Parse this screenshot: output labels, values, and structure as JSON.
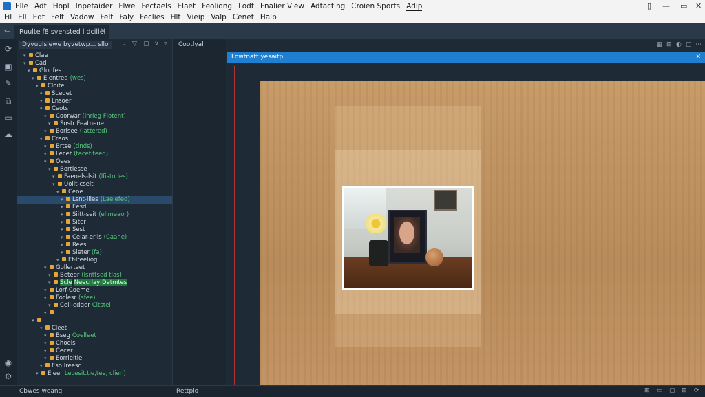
{
  "menubar": {
    "row1": [
      "Elle",
      "Adt",
      "Hopl",
      "Inpetaider",
      "Flwe",
      "Fectaels",
      "Elaet",
      "Feoliong",
      "Lodt",
      "Fnalier View",
      "Adtacting",
      "Croien Sports",
      "Adip"
    ],
    "row2": [
      "Fil",
      "Ell",
      "Edt",
      "Felt",
      "Vadow",
      "Felt",
      "Faly",
      "Feclies",
      "Hlt",
      "Vieip",
      "Valp",
      "Cenet",
      "Halp"
    ],
    "window_controls": [
      "▯",
      "—",
      "▭",
      "✕"
    ]
  },
  "tab": {
    "label": "Ruulte f8 svensted l dcillel",
    "close": "✕"
  },
  "tree": {
    "header_title": "Dyvuulsiewe byvetwp… sllo",
    "rows": [
      {
        "depth": 1,
        "label": "Clae"
      },
      {
        "depth": 1,
        "label": "Cad"
      },
      {
        "depth": 2,
        "label": "Glonfes"
      },
      {
        "depth": 3,
        "label": "Elentred",
        "detail": "(wes)"
      },
      {
        "depth": 4,
        "label": "Cloite"
      },
      {
        "depth": 5,
        "label": "Scedet"
      },
      {
        "depth": 5,
        "label": "Lnsoer"
      },
      {
        "depth": 5,
        "label": "Ceots"
      },
      {
        "depth": 6,
        "label": "Coorwar",
        "detail": "(inrleg Flotent)"
      },
      {
        "depth": 7,
        "label": "Sostr Featnene"
      },
      {
        "depth": 6,
        "label": "Borisee",
        "detail": "(lattered)"
      },
      {
        "depth": 5,
        "label": "Creos"
      },
      {
        "depth": 6,
        "label": "Brtse",
        "detail": "(tinds)"
      },
      {
        "depth": 6,
        "label": "Lecet",
        "detail": "(tacetiteed)"
      },
      {
        "depth": 6,
        "label": "Oaes"
      },
      {
        "depth": 7,
        "label": "Bortlesse"
      },
      {
        "depth": 8,
        "label": "Faenels-lsit",
        "detail": "(lfistodes)"
      },
      {
        "depth": 8,
        "label": "Uoilt-cselt"
      },
      {
        "depth": 9,
        "label": "Ceoe"
      },
      {
        "depth": 10,
        "label": "Lsnt-liies",
        "detail": "(Laelefed)",
        "selected": true
      },
      {
        "depth": 10,
        "label": "Eesd"
      },
      {
        "depth": 10,
        "label": "Siitt-seit",
        "detail": "(ellmeaor)"
      },
      {
        "depth": 10,
        "label": "Siter"
      },
      {
        "depth": 10,
        "label": "Sest"
      },
      {
        "depth": 10,
        "label": "Ceiar-erlls",
        "detail": "(Caane)"
      },
      {
        "depth": 10,
        "label": "Rees"
      },
      {
        "depth": 10,
        "label": "Sleter",
        "detail": "(fa)"
      },
      {
        "depth": 9,
        "label": "Ef-lteeliog"
      },
      {
        "depth": 6,
        "label": "Gollerteet"
      },
      {
        "depth": 7,
        "label": "Beteer",
        "detail": "(lsnttsed tlas)"
      },
      {
        "depth": 7,
        "label": "Scle",
        "detail": "Neecrlay Detmtes",
        "highlight": true
      },
      {
        "depth": 6,
        "label": "Lorf-Coeme"
      },
      {
        "depth": 6,
        "label": "Foclesr",
        "detail": "(sfee)"
      },
      {
        "depth": 7,
        "label": "Ceil-edger",
        "detail": "Cltstel"
      },
      {
        "depth": 6,
        "label": ""
      },
      {
        "depth": 3,
        "label": ""
      },
      {
        "depth": 5,
        "label": "Cleet"
      },
      {
        "depth": 6,
        "label": "Bseg",
        "detail": "Coelleet"
      },
      {
        "depth": 6,
        "label": "Choeis"
      },
      {
        "depth": 6,
        "label": "Cecer"
      },
      {
        "depth": 6,
        "label": "Eorrleltiel"
      },
      {
        "depth": 5,
        "label": "Eso Ireesd"
      },
      {
        "depth": 4,
        "label": "Eleer",
        "detail": "Lecesit.tie,tee, clierl)"
      }
    ]
  },
  "panel2": {
    "title": "Cootlyal"
  },
  "editor": {
    "tab_label": "Lowtnatt yesaitp",
    "toolbar_icons": [
      "grid-icon",
      "split-icon",
      "pin-icon",
      "close-icon",
      "square-icon",
      "square-icon",
      "more-icon",
      "more-icon"
    ]
  },
  "status": {
    "left": "Cbwes weang",
    "middle": "Rettplo"
  }
}
